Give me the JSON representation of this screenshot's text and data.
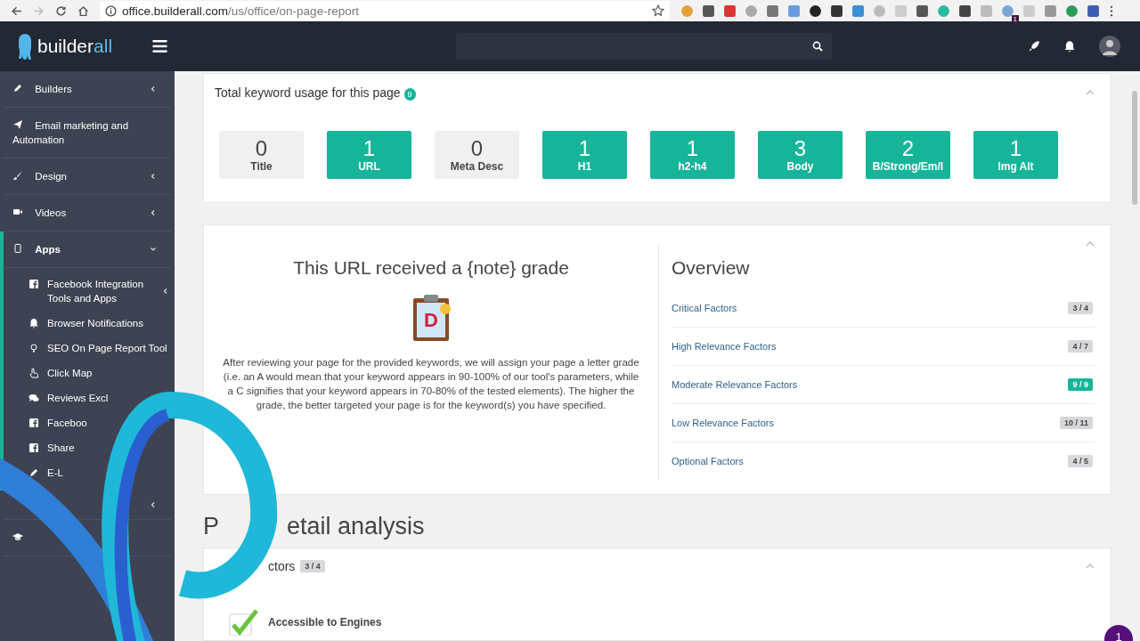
{
  "browser": {
    "url_host": "office.builderall.com",
    "url_path": "/us/office/on-page-report",
    "extension_badge": "1"
  },
  "topbar": {
    "logo_main": "builder",
    "logo_accent": "all"
  },
  "sidebar": {
    "items": [
      {
        "label": "Builders",
        "expanded": false,
        "selected": false
      },
      {
        "label": "Email marketing and Automation",
        "selected": false
      },
      {
        "label": "Design",
        "expanded": false,
        "selected": false
      },
      {
        "label": "Videos",
        "expanded": false,
        "selected": false
      },
      {
        "label": "Apps",
        "expanded": true,
        "selected": true,
        "children": [
          {
            "label": "Facebook Integration Tools and Apps",
            "expanded": false
          },
          {
            "label": "Browser Notifications"
          },
          {
            "label": "SEO On Page Report Tool"
          },
          {
            "label": "Click Map"
          },
          {
            "label": "Reviews Excl"
          },
          {
            "label": "Faceboo"
          },
          {
            "label": "Share"
          },
          {
            "label": "E-L"
          }
        ]
      },
      {
        "expanded": false,
        "selected": false
      },
      {
        "selected": false
      }
    ]
  },
  "keyword_usage": {
    "title": "Total keyword usage for this page",
    "count": "9",
    "expanded": true,
    "tiles": [
      {
        "value": "0",
        "label": "Title",
        "found": false
      },
      {
        "value": "1",
        "label": "URL",
        "found": true
      },
      {
        "value": "0",
        "label": "Meta Desc",
        "found": false
      },
      {
        "value": "1",
        "label": "H1",
        "found": true
      },
      {
        "value": "1",
        "label": "h2-h4",
        "found": true
      },
      {
        "value": "3",
        "label": "Body",
        "found": true
      },
      {
        "value": "2",
        "label": "B/Strong/Em/I",
        "found": true
      },
      {
        "value": "1",
        "label": "Img Alt",
        "found": true
      }
    ]
  },
  "grade": {
    "heading": "This URL received a {note} grade",
    "letter": "D",
    "text": "After reviewing your page for the provided keywords, we will assign your page a letter grade (i.e. an A would mean that your keyword appears in 90-100% of our tool's parameters, while a C signifies that your keyword appears in 70-80% of the tested elements). The higher the grade, the better targeted your page is for the keyword(s) you have specified.",
    "expanded": true
  },
  "overview": {
    "title": "Overview",
    "rows": [
      {
        "label": "Critical Factors",
        "score": "3 / 4",
        "complete": false
      },
      {
        "label": "High Relevance Factors",
        "score": "4 / 7",
        "complete": false
      },
      {
        "label": "Moderate Relevance Factors",
        "score": "9 / 9",
        "complete": true
      },
      {
        "label": "Low Relevance Factors",
        "score": "10 / 11",
        "complete": false
      },
      {
        "label": "Optional Factors",
        "score": "4 / 5",
        "complete": false
      }
    ]
  },
  "detail": {
    "heading_start": "P",
    "heading_end": "etail analysis",
    "section_title": "ctors",
    "section_score": "3 / 4",
    "expanded": true,
    "checks": [
      {
        "label": "Accessible to Engines",
        "passed": true
      }
    ]
  },
  "chat": {
    "count": "1"
  }
}
